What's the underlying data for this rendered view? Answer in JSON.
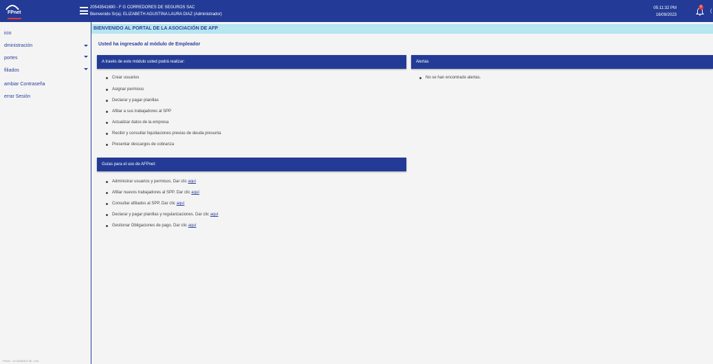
{
  "header": {
    "logo_text": "FPnet",
    "company": "20543541690 - F G CORREDORES DE SEGUROS SAC",
    "welcome": "Bienvenido Sr(a). ELIZABETH AGUSTINA LAURA DIAZ (Administrador)",
    "time": "05:11:32 PM",
    "date": "16/09/2023",
    "notification_count": "0",
    "corner_mark": "("
  },
  "sidebar": {
    "items": [
      {
        "label": "icio"
      },
      {
        "label": "dministración"
      },
      {
        "label": "portes"
      },
      {
        "label": "filiados"
      },
      {
        "label": "ambiar Contraseña"
      },
      {
        "label": "errar Sesión"
      }
    ],
    "version": "FPnet - 10.230828.5 SE -216"
  },
  "main": {
    "banner": "BIENVENIDO AL PORTAL DE LA ASOCIACIÓN DE AFP",
    "subheading": "Usted ha ingresado al módulo de Empleador",
    "features_title": "A través de este módulo usted podrá realizar:",
    "features": [
      "Crear usuarios",
      "Asignar permisos",
      "Declarar y pagar planillas",
      "Afiliar a sus trabajadores al SPP",
      "Actualizar datos de la empresa",
      "Recibir y consultar liquidaciones previas de deuda presunta",
      "Presentar descargos de cobranza"
    ],
    "guides_title": "Guías para el uso de AFPnet:",
    "guides": [
      {
        "text": "Administrar usuarios y permisos. Dar clic ",
        "link": "aquí"
      },
      {
        "text": "Afiliar nuevos trabajadores al SPP. Dar clic ",
        "link": "aquí"
      },
      {
        "text": "Consultar afiliados al SPP. Dar clic ",
        "link": "aquí"
      },
      {
        "text": "Declarar y pagar planillas y regularizaciones. Dar clic ",
        "link": "aquí"
      },
      {
        "text": "Gestionar Obligaciones de pago. Dar clic ",
        "link": "aquí"
      }
    ],
    "alerts_title": "Alertas",
    "alerts_empty": "No se han encontrado alertas."
  },
  "colors": {
    "primary": "#233b96",
    "banner_bg": "#b6e6f0",
    "badge": "#e53935"
  }
}
